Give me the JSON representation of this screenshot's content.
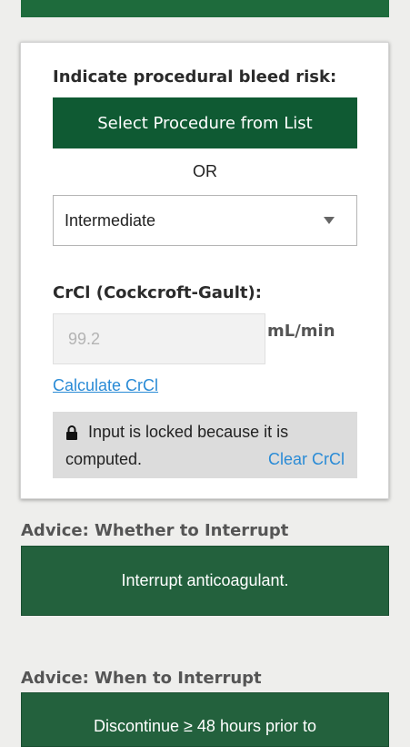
{
  "colors": {
    "primary_green": "#0f5a33",
    "advice_green": "#23613d",
    "link_blue": "#2a8bd6",
    "locked_bg": "#dcdcdc"
  },
  "bleed_risk": {
    "heading": "Indicate procedural bleed risk:",
    "select_button_label": "Select Procedure from List",
    "or_text": "OR",
    "dropdown_selected": "Intermediate"
  },
  "crcl": {
    "label": "CrCl (Cockcroft-Gault):",
    "value": "99.2",
    "unit": "mL/min",
    "calculate_link": "Calculate CrCl",
    "lock_icon": "lock-icon",
    "locked_line1": "Input is locked because it is",
    "locked_line2": "computed.",
    "clear_link": "Clear CrCl"
  },
  "advice_interrupt": {
    "title": "Advice: Whether to Interrupt",
    "text": "Interrupt anticoagulant."
  },
  "advice_when": {
    "title": "Advice: When to Interrupt",
    "text": "Discontinue ≥ 48 hours prior to"
  }
}
